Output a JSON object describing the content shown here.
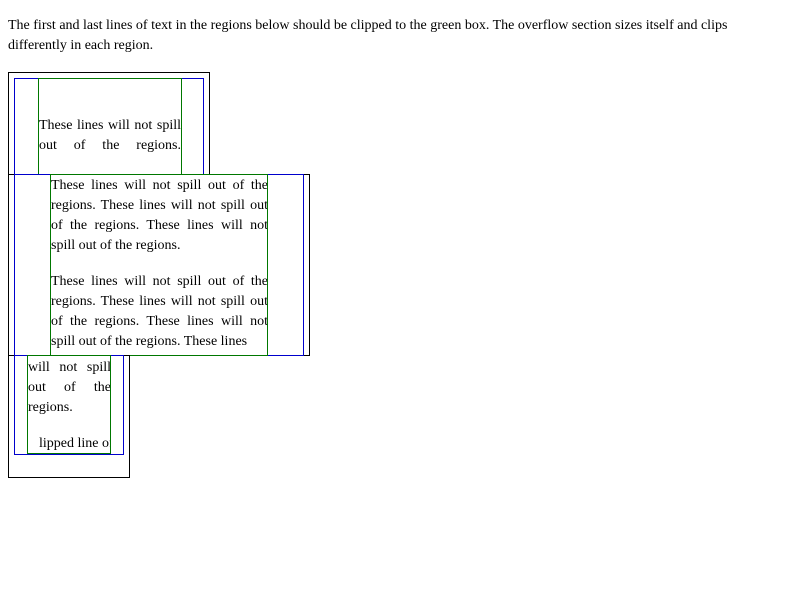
{
  "intro": "The first and last lines of text in the regions below should be clipped to the green box. The overflow section sizes itself and clips differently in each region.",
  "region1": {
    "lines": [
      "These lines will not spill",
      "out of the regions."
    ]
  },
  "region2": {
    "para1": "These lines will not spill out of the regions. These lines will not spill out of the regions. These lines will not spill out of the regions.",
    "para2": "These lines will not spill out of the regions. These lines will not spill out of the regions. These lines will not spill out of the regions. These lines"
  },
  "region3": {
    "lines": [
      "will not spill",
      "out of the",
      "regions."
    ],
    "clipped_line": "lipped line of"
  }
}
